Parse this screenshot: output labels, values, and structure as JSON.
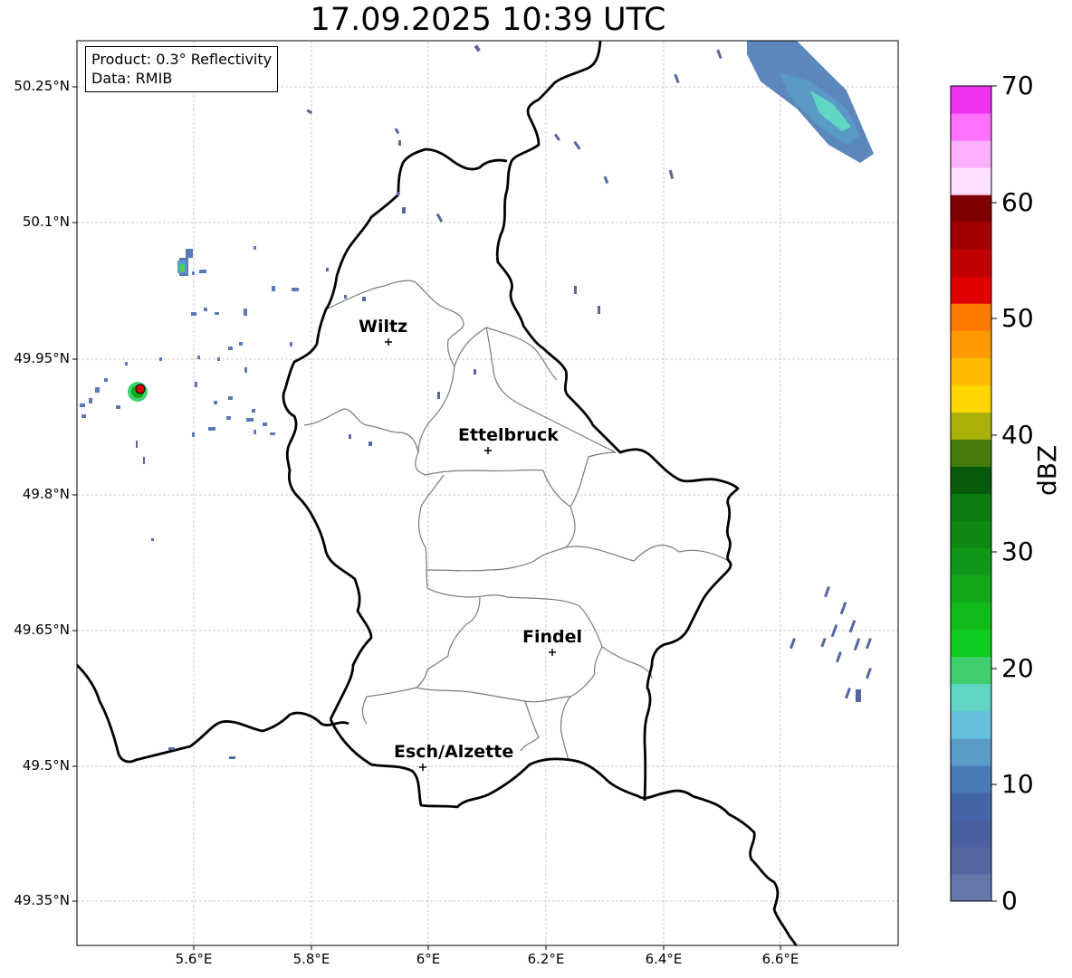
{
  "title": "17.09.2025 10:39 UTC",
  "info": {
    "product": "Product: 0.3° Reflectivity",
    "data": "Data: RMIB"
  },
  "lat_ticks": [
    "50.25°N",
    "50.1°N",
    "49.95°N",
    "49.8°N",
    "49.65°N",
    "49.5°N",
    "49.35°N"
  ],
  "lon_ticks": [
    "5.6°E",
    "5.8°E",
    "6°E",
    "6.2°E",
    "6.4°E",
    "6.6°E"
  ],
  "cities": [
    "Wiltz",
    "Ettelbruck",
    "Findel",
    "Esch/Alzette"
  ],
  "colorbar": {
    "unit": "dBZ",
    "tick_labels": [
      "0",
      "10",
      "20",
      "30",
      "40",
      "50",
      "60",
      "70"
    ],
    "colors": [
      "#6677aa",
      "#5566a0",
      "#4a5fa0",
      "#4466a8",
      "#4a7ab5",
      "#5a9cc5",
      "#66c0dd",
      "#62d6c5",
      "#40d070",
      "#10cc20",
      "#11bb1a",
      "#10a818",
      "#0f9818",
      "#0e8a14",
      "#0d7a12",
      "#085a0c",
      "#457a0c",
      "#aab00a",
      "#ffd600",
      "#ffbb00",
      "#ff9a00",
      "#ff7a00",
      "#e00000",
      "#c00000",
      "#a00000",
      "#800000",
      "#ffe0ff",
      "#ffb0ff",
      "#ff70ff",
      "#ee33ee"
    ]
  },
  "map_colors": {
    "border": "#000000",
    "cantons": "#7a7a7a",
    "grid": "#c8c8c8",
    "marker": "#e00000"
  }
}
